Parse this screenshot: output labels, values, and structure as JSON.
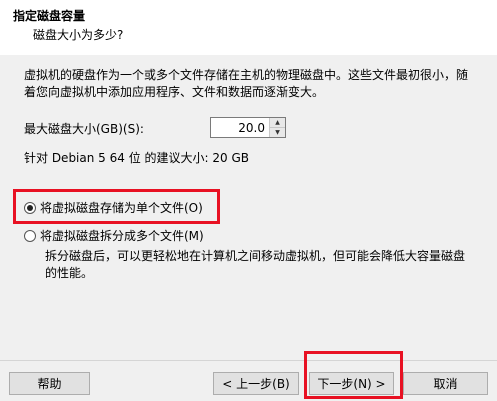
{
  "header": {
    "title": "指定磁盘容量",
    "subtitle": "磁盘大小为多少?"
  },
  "description": "虚拟机的硬盘作为一个或多个文件存储在主机的物理磁盘中。这些文件最初很小，随着您向虚拟机中添加应用程序、文件和数据而逐渐变大。",
  "disk_size": {
    "label": "最大磁盘大小(GB)(S):",
    "value": "20.0",
    "recommendation": "针对 Debian 5 64 位 的建议大小: 20 GB"
  },
  "options": {
    "single_file": {
      "label": "将虚拟磁盘存储为单个文件(O)",
      "selected": true
    },
    "multi_file": {
      "label": "将虚拟磁盘拆分成多个文件(M)",
      "selected": false
    },
    "split_description": "拆分磁盘后，可以更轻松地在计算机之间移动虚拟机，但可能会降低大容量磁盘的性能。"
  },
  "buttons": {
    "help": "帮助",
    "prev": "< 上一步(B)",
    "next": "下一步(N) >",
    "cancel": "取消"
  },
  "colors": {
    "highlight": "#e81123",
    "background": "#f0f0f0"
  }
}
